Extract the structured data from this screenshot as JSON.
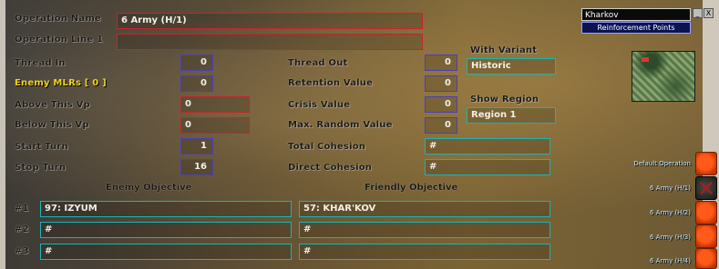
{
  "form": {
    "operation_name_label": "Operation Name",
    "operation_name_value": "6 Army (H/1)",
    "operation_line_label": "Operation Line 1",
    "operation_line_value": "",
    "thread_in_label": "Thread In",
    "thread_in_value": "0",
    "enemy_mlrs_label": "Enemy MLRs [  0 ]",
    "enemy_mlrs_value": "0",
    "above_vp_label": "Above This Vp",
    "above_vp_value": "0",
    "below_vp_label": "Below This Vp",
    "below_vp_value": "0",
    "start_turn_label": "Start Turn",
    "start_turn_value": "1",
    "stop_turn_label": "Stop Turn",
    "stop_turn_value": "16",
    "thread_out_label": "Thread Out",
    "thread_out_value": "0",
    "retention_label": "Retention Value",
    "retention_value": "0",
    "crisis_label": "Crisis Value",
    "crisis_value": "0",
    "max_random_label": "Max. Random Value",
    "max_random_value": "0",
    "total_cohesion_label": "Total  Cohesion",
    "total_cohesion_value": "#",
    "direct_cohesion_label": "Direct Cohesion",
    "direct_cohesion_value": "#",
    "with_variant_label": "With Variant",
    "with_variant_value": "Historic",
    "show_region_label": "Show Region",
    "show_region_value": "Region 1"
  },
  "objectives": {
    "enemy_header": "Enemy Objective",
    "friendly_header": "Friendly Objective",
    "rows": [
      {
        "label": "#1",
        "enemy": "97: IZYUM",
        "friendly": "57: KHAR'KOV"
      },
      {
        "label": "#2",
        "enemy": "#",
        "friendly": "#"
      },
      {
        "label": "#3",
        "enemy": "#",
        "friendly": "#"
      }
    ]
  },
  "side_panel": {
    "location": "Kharkov",
    "reinforcement_label": "Reinforcement Points",
    "minimize_label": "_",
    "close_label": "X",
    "operations": [
      {
        "label": "Default Operation",
        "selected": false
      },
      {
        "label": "6 Army (H/1)",
        "selected": true
      },
      {
        "label": "6 Army (H/2)",
        "selected": false
      },
      {
        "label": "6 Army (H/3)",
        "selected": false
      },
      {
        "label": "6 Army (H/4)",
        "selected": false
      }
    ]
  },
  "colors": {
    "field_red": "#c4262a",
    "field_blue": "#4a3fb8",
    "field_cyan": "#19b5b5",
    "label_yellow": "#f0d21e",
    "op_button": "#ff5a1a"
  }
}
